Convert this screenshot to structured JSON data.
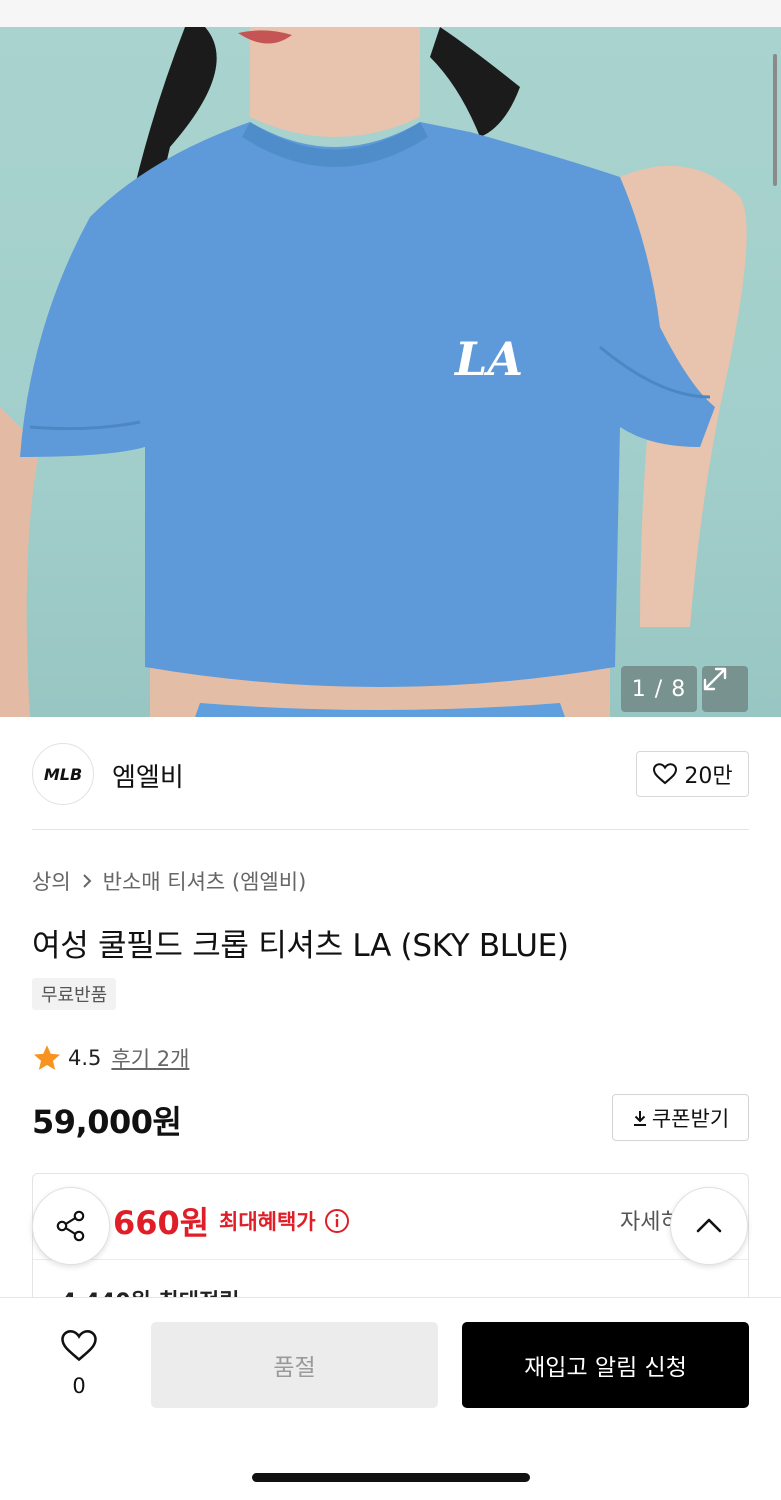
{
  "gallery": {
    "counter": "1 / 8"
  },
  "brand": {
    "logo_text": "MLB",
    "name": "엠엘비",
    "likes": "20만"
  },
  "breadcrumb": {
    "category": "상의",
    "subcategory": "반소매 티셔츠 (엠엘비)"
  },
  "product": {
    "title": "여성 쿨필드 크롭 티셔츠 LA (SKY BLUE)",
    "badge": "무료반품",
    "rating": "4.5",
    "reviews": "후기 2개",
    "price": "59,000원",
    "coupon_label": "쿠폰받기",
    "tshirt_logo": "LA"
  },
  "benefit": {
    "price": "660원",
    "label": "최대혜택가",
    "detail": "자세히",
    "points": "4,440원 최대적립"
  },
  "bottom": {
    "wish_count": "0",
    "soldout_label": "품절",
    "notify_label": "재입고 알림 신청"
  },
  "colors": {
    "accent_red": "#e01e27",
    "shirt_blue": "#5d9ad8",
    "background_teal": "#a6d1cd"
  }
}
